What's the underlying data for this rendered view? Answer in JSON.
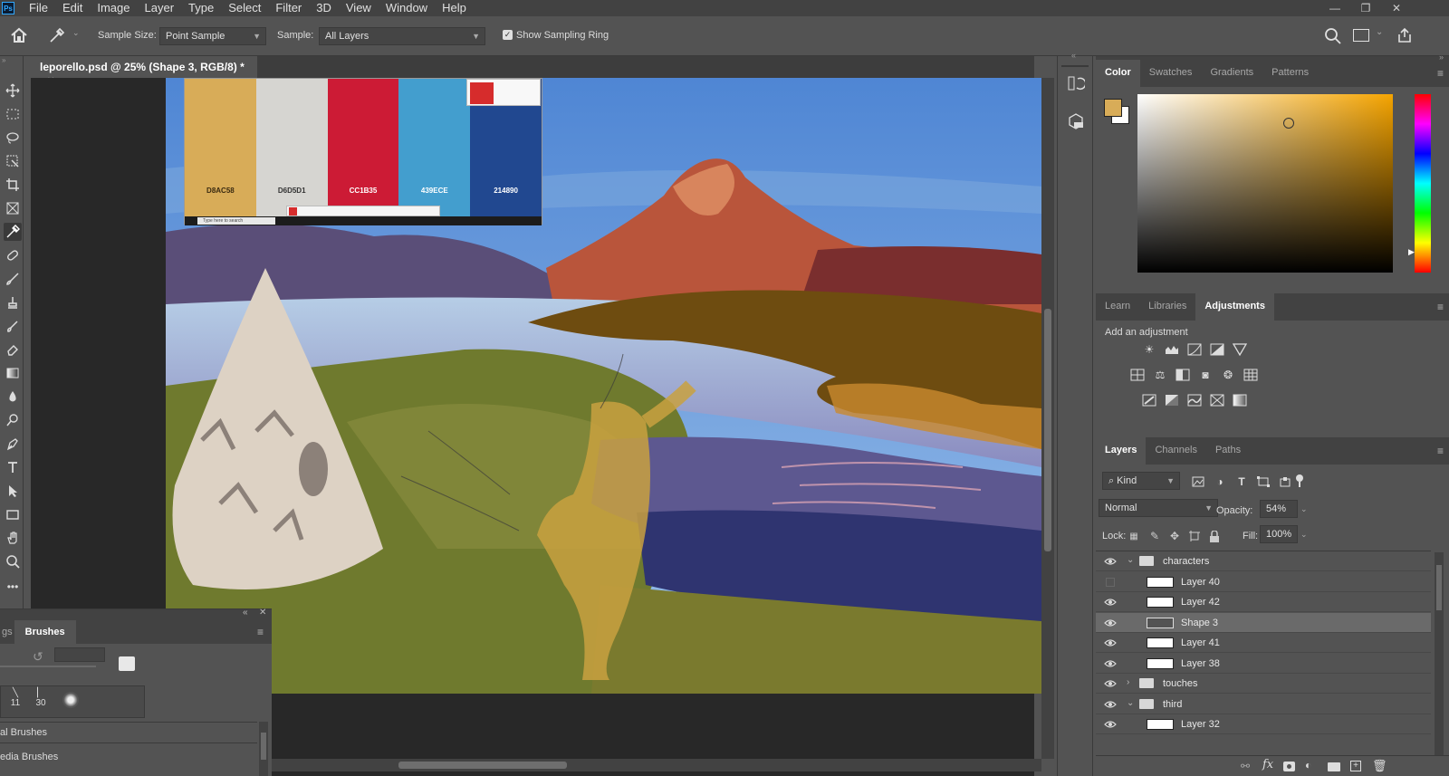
{
  "app": {
    "logo_text": "Ps"
  },
  "menu": [
    "File",
    "Edit",
    "Image",
    "Layer",
    "Type",
    "Select",
    "Filter",
    "3D",
    "View",
    "Window",
    "Help"
  ],
  "window_controls": {
    "minimize": "—",
    "restore": "❐",
    "close": "✕"
  },
  "options": {
    "sample_size_label": "Sample Size:",
    "sample_size_value": "Point Sample",
    "sample_label": "Sample:",
    "sample_value": "All Layers",
    "show_sampling_ring": "Show Sampling Ring",
    "show_sampling_ring_checked": true
  },
  "document": {
    "tab_title": "leporello.psd @ 25% (Shape 3, RGB/8) *",
    "close": "✕"
  },
  "palette_swatches": [
    {
      "hex": "D8AC58",
      "color": "#D8AC58"
    },
    {
      "hex": "D6D5D1",
      "color": "#D6D5D1"
    },
    {
      "hex": "CC1B35",
      "color": "#CC1B35"
    },
    {
      "hex": "439ECE",
      "color": "#439ECE"
    },
    {
      "hex": "214890",
      "color": "#214890"
    }
  ],
  "taskbar": {
    "search_placeholder": "Type here to search"
  },
  "color_panel": {
    "tabs": [
      "Color",
      "Swatches",
      "Gradients",
      "Patterns"
    ],
    "active_tab": "Color",
    "foreground": "#D8AC58",
    "background": "#ffffff"
  },
  "adjustments_panel": {
    "tabs": [
      "Learn",
      "Libraries",
      "Adjustments"
    ],
    "active_tab": "Adjustments",
    "heading": "Add an adjustment"
  },
  "layers_panel": {
    "tabs": [
      "Layers",
      "Channels",
      "Paths"
    ],
    "active_tab": "Layers",
    "filter_kind": "Kind",
    "blend_mode": "Normal",
    "opacity_label": "Opacity:",
    "opacity_value": "54%",
    "lock_label": "Lock:",
    "fill_label": "Fill:",
    "fill_value": "100%",
    "rows": [
      {
        "name": "characters",
        "type": "group",
        "expanded": true,
        "visible": true,
        "selected": false
      },
      {
        "name": "Layer 40",
        "type": "layer",
        "visible": false,
        "selected": false
      },
      {
        "name": "Layer 42",
        "type": "layer",
        "visible": true,
        "selected": false
      },
      {
        "name": "Shape 3",
        "type": "shape",
        "visible": true,
        "selected": true
      },
      {
        "name": "Layer 41",
        "type": "layer",
        "visible": true,
        "selected": false
      },
      {
        "name": "Layer 38",
        "type": "layer",
        "visible": true,
        "selected": false
      },
      {
        "name": "touches",
        "type": "group",
        "expanded": false,
        "visible": true,
        "selected": false
      },
      {
        "name": "third",
        "type": "group",
        "expanded": true,
        "visible": true,
        "selected": false
      },
      {
        "name": "Layer 32",
        "type": "layer",
        "visible": true,
        "selected": false
      }
    ]
  },
  "brushes_panel": {
    "tab_prev": "gs",
    "tab_active": "Brushes",
    "presets": [
      {
        "size": "11"
      },
      {
        "size": "30"
      }
    ],
    "folders": [
      "al Brushes",
      "edia Brushes"
    ]
  }
}
